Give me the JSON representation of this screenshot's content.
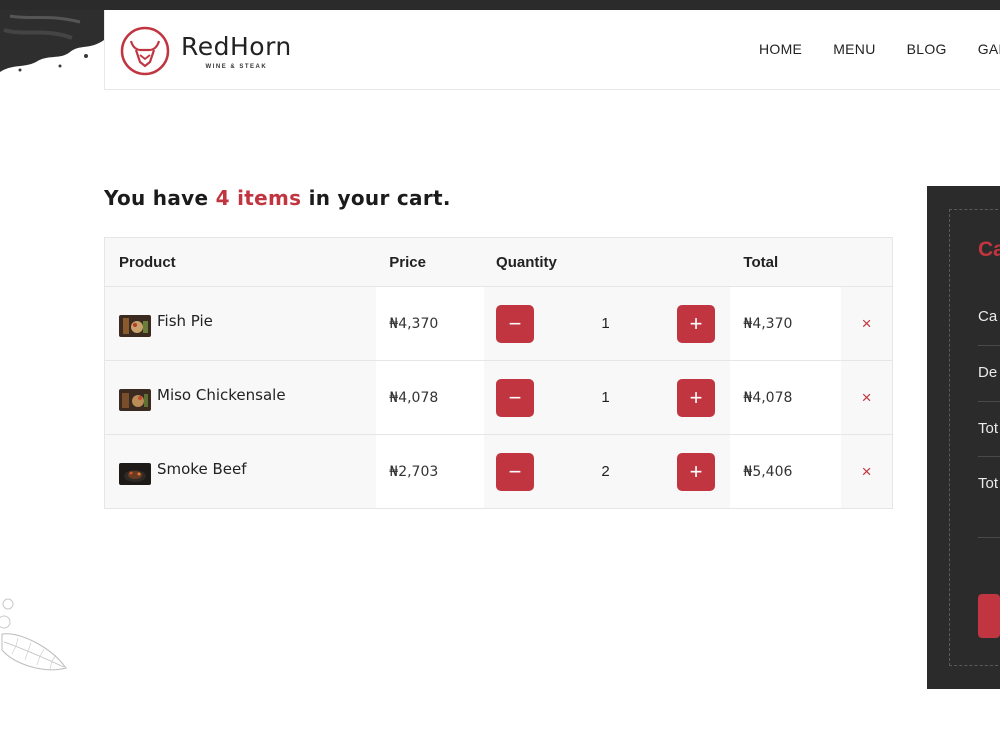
{
  "colors": {
    "accent": "#c0353f",
    "dark": "#2b2b2b"
  },
  "header": {
    "brand_name": "RedHorn",
    "brand_tagline": "WINE & STEAK",
    "nav": [
      "HOME",
      "MENU",
      "BLOG",
      "GAL"
    ]
  },
  "cart": {
    "heading_prefix": "You have",
    "heading_count": "4 items",
    "heading_suffix": "in your cart.",
    "columns": {
      "product": "Product",
      "price": "Price",
      "quantity": "Quantity",
      "total": "Total"
    },
    "items": [
      {
        "name": "Fish Pie",
        "price": "₦4,370",
        "quantity": "1",
        "total": "₦4,370"
      },
      {
        "name": "Miso Chickensale",
        "price": "₦4,078",
        "quantity": "1",
        "total": "₦4,078"
      },
      {
        "name": "Smoke Beef",
        "price": "₦2,703",
        "quantity": "2",
        "total": "₦5,406"
      }
    ],
    "minus_symbol": "−",
    "plus_symbol": "+",
    "remove_symbol": "×"
  },
  "summary": {
    "title": "Ca",
    "rows": [
      "Ca",
      "De",
      "Tot",
      "Tot"
    ]
  }
}
